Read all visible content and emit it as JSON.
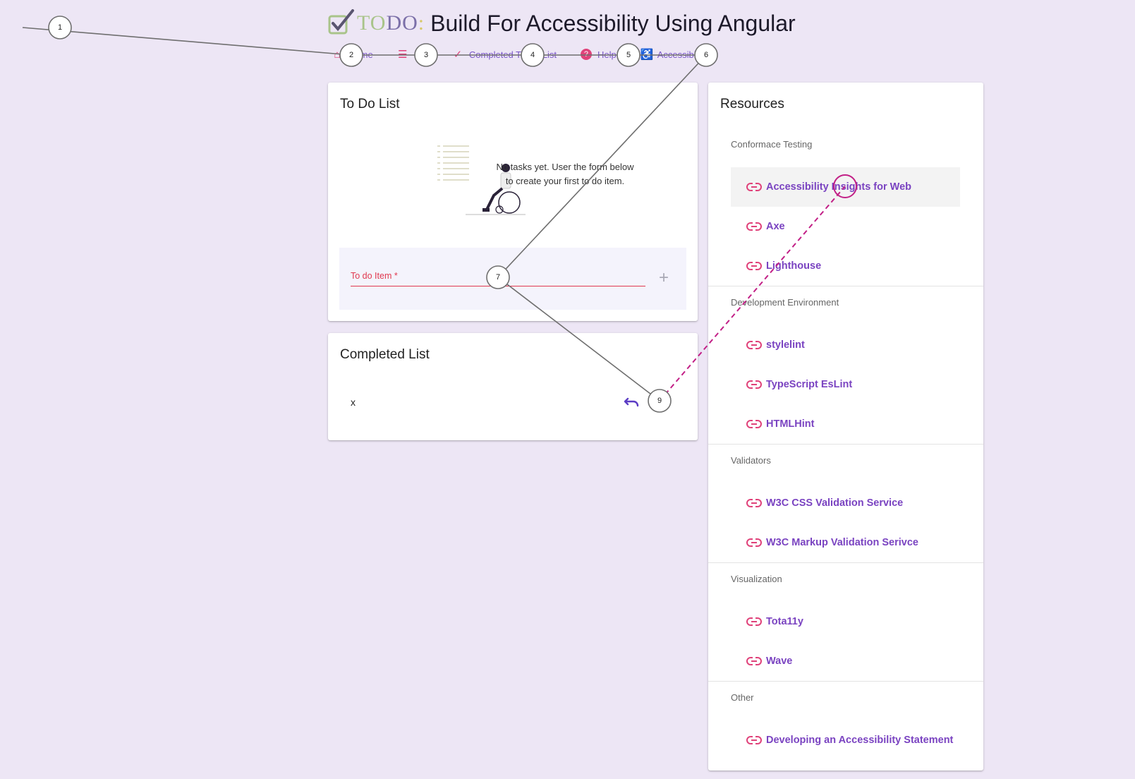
{
  "header": {
    "logo": {
      "to": "TO",
      "do": "DO",
      "colon": ":"
    },
    "title": "Build For Accessibility Using Angular"
  },
  "nav": [
    {
      "icon": "home-icon",
      "label": "Home"
    },
    {
      "icon": "list-icon",
      "label": "List"
    },
    {
      "icon": "check-icon",
      "label": "Completed To Do List"
    },
    {
      "icon": "help-icon",
      "label": "Help"
    },
    {
      "icon": "accessibility-icon",
      "label": "Accessibility"
    }
  ],
  "todo_card": {
    "title": "To Do List",
    "empty_text": "No tasks yet. User the form below to create your first to do item.",
    "input_label": "To do Item *",
    "input_value": "",
    "add_icon": "+"
  },
  "completed_card": {
    "title": "Completed List",
    "items": [
      {
        "text": "x"
      }
    ]
  },
  "resources": {
    "title": "Resources",
    "sections": [
      {
        "title": "Conformace Testing",
        "links": [
          "Accessibility Insights for Web",
          "Axe",
          "Lighthouse"
        ]
      },
      {
        "title": "Development Environment",
        "links": [
          "stylelint",
          "TypeScript EsLint",
          "HTMLHint"
        ]
      },
      {
        "title": "Validators",
        "links": [
          "W3C CSS Validation Service",
          "W3C Markup Validation Serivce"
        ]
      },
      {
        "title": "Visualization",
        "links": [
          "Tota11y",
          "Wave"
        ]
      },
      {
        "title": "Other",
        "links": [
          "Developing an Accessibility Statement"
        ]
      }
    ]
  },
  "markers": [
    "1",
    "2",
    "3",
    "4",
    "5",
    "6",
    "7",
    "9"
  ],
  "colors": {
    "background": "#ede6f5",
    "accent": "#e0427a",
    "link": "#7a43c1",
    "overlay_dash": "#c21f86"
  }
}
